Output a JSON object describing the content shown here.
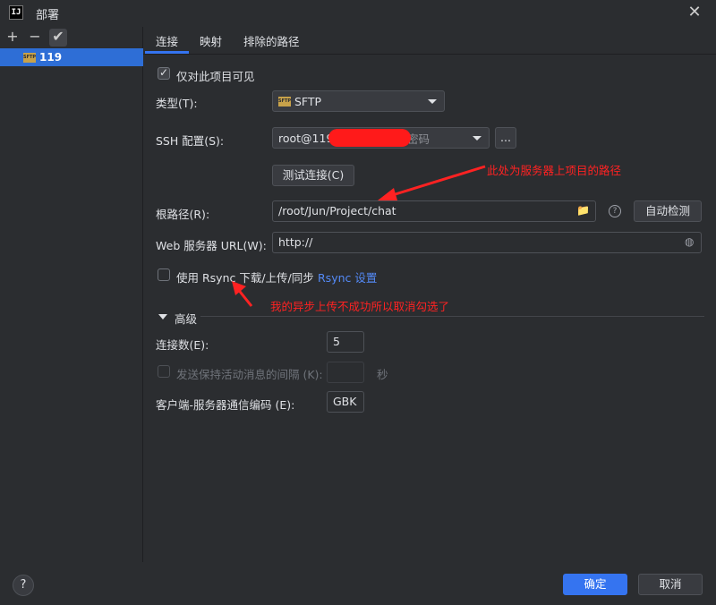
{
  "window": {
    "title": "部署",
    "app_icon_text": "IJ"
  },
  "toolbar": {
    "add": "+",
    "remove": "−",
    "apply": "✔"
  },
  "servers": [
    {
      "name": "119",
      "icon_text": "SFTP"
    }
  ],
  "tabs": [
    {
      "label": "连接"
    },
    {
      "label": "映射"
    },
    {
      "label": "排除的路径"
    }
  ],
  "form": {
    "visible_only_label": "仅对此项目可见",
    "type_label": "类型(T):",
    "type_value": "SFTP",
    "type_icon_text": "SFTP",
    "ssh_label": "SSH 配置(S):",
    "ssh_value": "root@119",
    "ssh_suffix": "密码",
    "ssh_more": "...",
    "test_button": "测试连接(C)",
    "root_label": "根路径(R):",
    "root_value": "/root/Jun/Project/chat",
    "autodetect_button": "自动检测",
    "help_glyph": "?",
    "url_label": "Web 服务器 URL(W):",
    "url_value": "http://",
    "rsync_label": "使用 Rsync 下载/上传/同步",
    "rsync_link": "Rsync 设置"
  },
  "advanced": {
    "header": "高级",
    "connections_label": "连接数(E):",
    "connections_value": "5",
    "keepalive_label": "发送保持活动消息的间隔 (K):",
    "keepalive_value": "",
    "keepalive_unit": "秒",
    "encoding_label": "客户端-服务器通信编码 (E):",
    "encoding_value": "GBK"
  },
  "annotations": {
    "root_path_note": "此处为服务器上项目的路径",
    "rsync_note": "我的异步上传不成功所以取消勾选了"
  },
  "footer": {
    "help": "?",
    "ok": "确定",
    "cancel": "取消"
  },
  "colors": {
    "accent": "#3574f0",
    "annotation": "#ff2222",
    "background": "#2b2d30"
  }
}
